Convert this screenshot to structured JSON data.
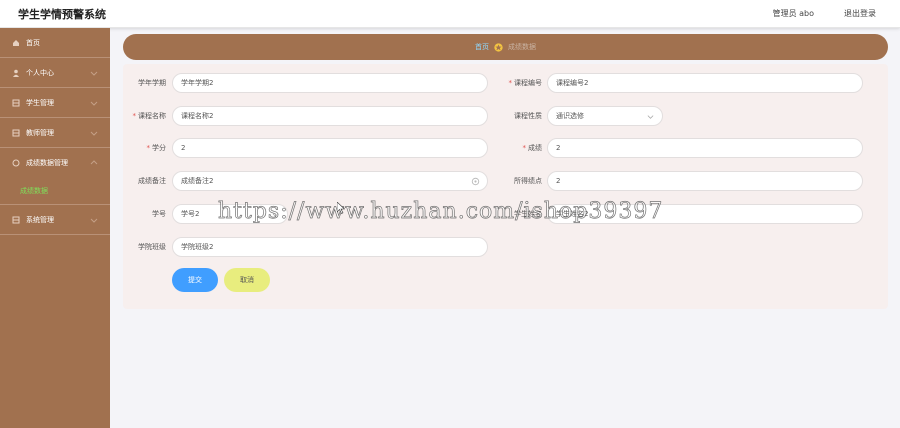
{
  "header": {
    "app_title": "学生学情预警系统",
    "user_info": "管理员 abo",
    "logout_label": "退出登录"
  },
  "sidebar": {
    "items": [
      {
        "label": "首页",
        "icon": "home-icon"
      },
      {
        "label": "个人中心",
        "icon": "user-icon"
      },
      {
        "label": "学生管理",
        "icon": "grid-icon"
      },
      {
        "label": "教师管理",
        "icon": "grid-icon"
      },
      {
        "label": "成绩数据管理",
        "icon": "grid-icon"
      },
      {
        "label": "系统管理",
        "icon": "grid-icon"
      }
    ],
    "sub_item": "成绩数据"
  },
  "breadcrumb": {
    "home": "首页",
    "current": "成绩数据",
    "star_icon": "star-icon"
  },
  "form": {
    "term": {
      "label": "学年学期",
      "value": "学年学期2"
    },
    "course_no": {
      "label": "课程编号",
      "value": "课程编号2"
    },
    "course_name": {
      "label": "课程名称",
      "value": "课程名称2"
    },
    "course_type": {
      "label": "课程性质",
      "value": "通识选修"
    },
    "credit": {
      "label": "学分",
      "value": "2"
    },
    "score": {
      "label": "成绩",
      "value": "2"
    },
    "remark": {
      "label": "成绩备注",
      "value": "成绩备注2"
    },
    "gpa": {
      "label": "所得绩点",
      "value": "2"
    },
    "student_id": {
      "label": "学号",
      "value": "学号2"
    },
    "student_name": {
      "label": "学生姓名",
      "value": "学生姓名2"
    },
    "class_name": {
      "label": "学院班级",
      "value": "学院班级2"
    }
  },
  "buttons": {
    "submit": "提交",
    "cancel": "取消"
  },
  "watermark": "https://www.huzhan.com/ishop39397",
  "colors": {
    "sidebar": "#a1714f",
    "submit": "#409eff",
    "cancel": "#e8ed7e",
    "active_sub": "#7fe05a",
    "breadcrumb_home": "#8fd9ff"
  }
}
